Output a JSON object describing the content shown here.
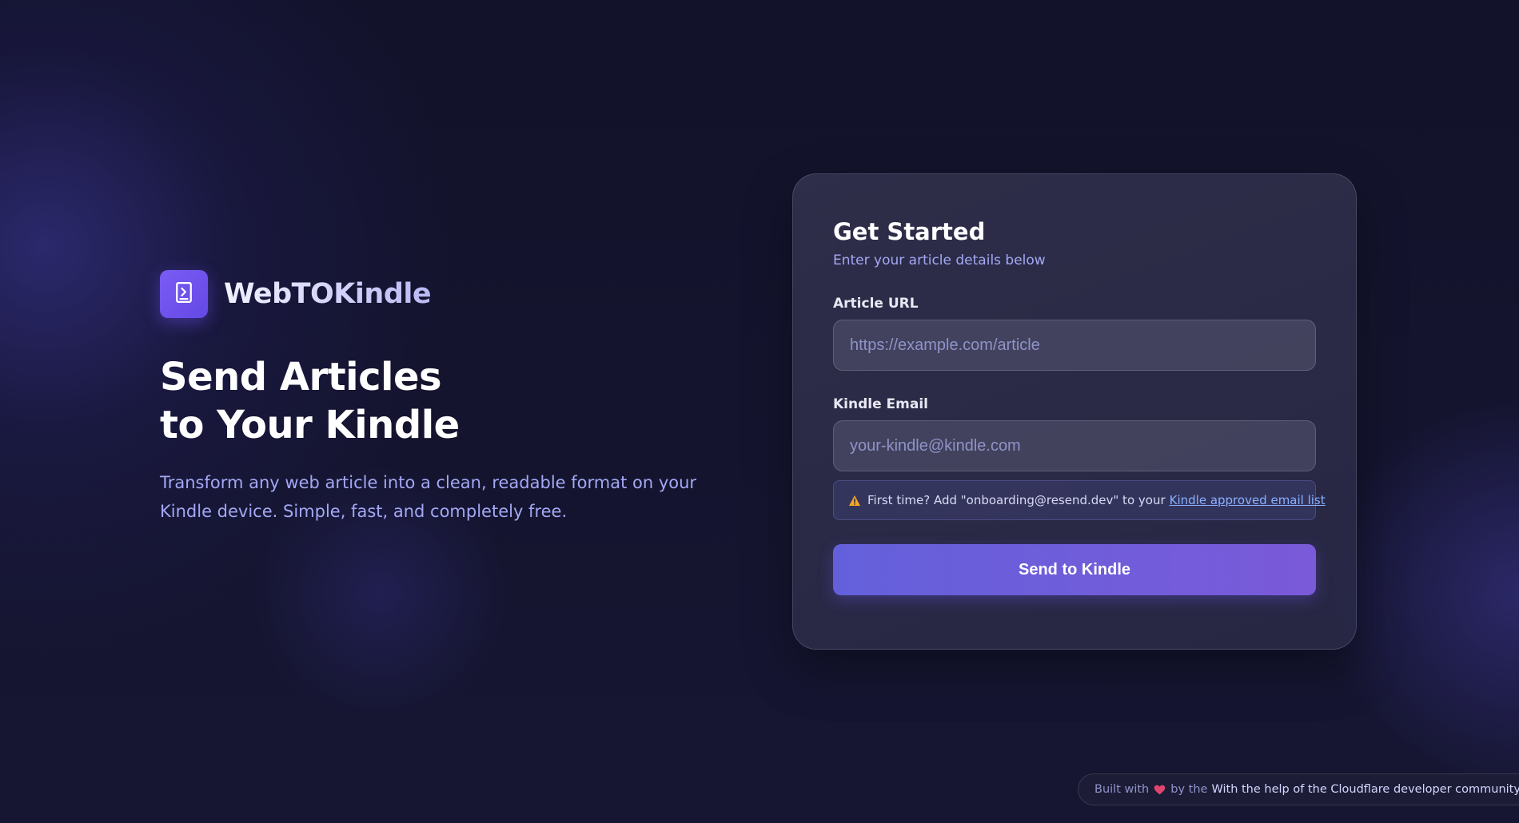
{
  "brand": {
    "name": "WebTOKindle",
    "logo_icon": "kindle-send-icon"
  },
  "hero": {
    "headline_line1": "Send Articles",
    "headline_line2": "to Your Kindle",
    "tagline": "Transform any web article into a clean, readable format on your Kindle device. Simple, fast, and completely free."
  },
  "form": {
    "title": "Get Started",
    "subtitle": "Enter your article details below",
    "url_label": "Article URL",
    "url_placeholder": "https://example.com/article",
    "url_value": "",
    "email_label": "Kindle Email",
    "email_placeholder": "your-kindle@kindle.com",
    "email_value": "",
    "notice_icon": "warning-icon",
    "notice_text": "First time? Add \"onboarding@resend.dev\" to your",
    "notice_link": "Kindle approved email list",
    "submit_label": "Send to Kindle"
  },
  "footer": {
    "prefix": "Built with",
    "heart_icon": "heart-icon",
    "middle": "by the",
    "credit": "With the help of the Cloudflare developer community"
  },
  "colors": {
    "background": "#141429",
    "accent": "#6a52e8",
    "subtitle": "#a4a8f4",
    "link": "#8ab0ff",
    "warning": "#f5a623",
    "heart": "#e0456f"
  }
}
